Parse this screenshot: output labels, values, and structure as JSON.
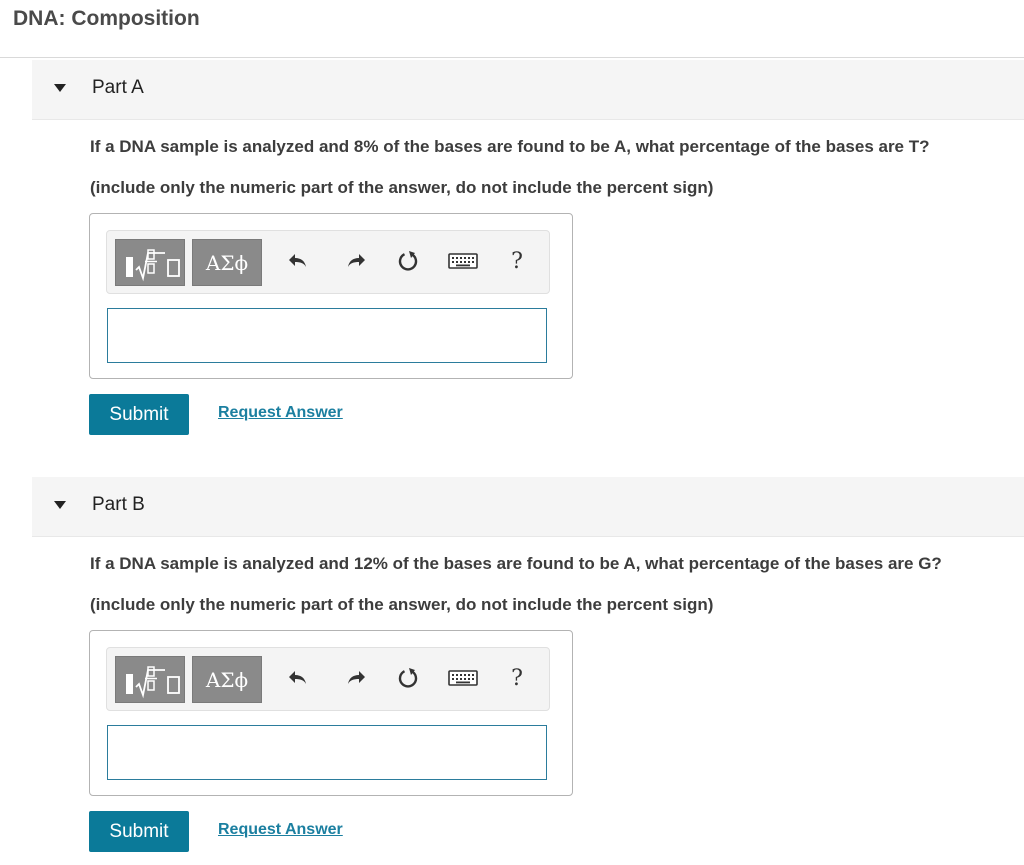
{
  "page": {
    "title": "DNA: Composition"
  },
  "parts": [
    {
      "label": "Part A",
      "question": "If a DNA sample is analyzed and 8% of the bases are found to be A, what percentage of the bases are T?",
      "instruction": "(include only the numeric part of the answer, do not include the percent sign)",
      "toolbar": {
        "templates_icon": "fraction-root-template-icon",
        "greek_label": "ΑΣϕ",
        "undo_icon": "undo-icon",
        "redo_icon": "redo-icon",
        "reset_icon": "reset-icon",
        "keyboard_icon": "keyboard-icon",
        "help_label": "?"
      },
      "answer_value": "",
      "submit_label": "Submit",
      "request_label": "Request Answer"
    },
    {
      "label": "Part B",
      "question": "If a DNA sample is analyzed and 12% of the bases are found to be A, what percentage of the bases are G?",
      "instruction": "(include only the numeric part of the answer, do not include the percent sign)",
      "toolbar": {
        "templates_icon": "fraction-root-template-icon",
        "greek_label": "ΑΣϕ",
        "undo_icon": "undo-icon",
        "redo_icon": "redo-icon",
        "reset_icon": "reset-icon",
        "keyboard_icon": "keyboard-icon",
        "help_label": "?"
      },
      "answer_value": "",
      "submit_label": "Submit",
      "request_label": "Request Answer"
    }
  ],
  "colors": {
    "submit_bg": "#0b7a99",
    "link": "#1b7fa0",
    "input_border": "#2b7c9c",
    "template_button": "#8a8a8a"
  }
}
